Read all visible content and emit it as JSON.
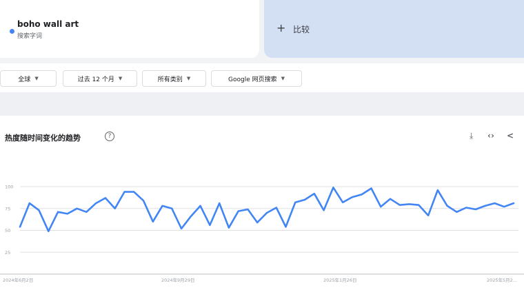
{
  "term": {
    "name": "boho wall art",
    "type": "搜索字词"
  },
  "compare": {
    "plus": "+",
    "label": "比较"
  },
  "filters": {
    "region": "全球",
    "time": "过去 12 个月",
    "category": "所有类别",
    "source": "Google 网页搜索"
  },
  "chart": {
    "title": "热度随时间变化的趋势",
    "help": "?",
    "download_icon": "⤓",
    "embed_icon": "‹›",
    "share_icon": "<"
  },
  "colors": {
    "series": "#4285f4",
    "grid": "#e0e0e0",
    "compare_bg": "#d3e0f3"
  },
  "chart_data": {
    "type": "line",
    "ylim": [
      0,
      100
    ],
    "yticks": [
      "100",
      "75",
      "50",
      "25"
    ],
    "xtick_labels": [
      "2024年6月2日",
      "2024年9月29日",
      "2025年1月26日",
      "2025年5月2..."
    ],
    "series": [
      {
        "values": [
          54,
          81,
          73,
          49,
          71,
          69,
          75,
          71,
          81,
          87,
          75,
          94,
          94,
          84,
          60,
          78,
          75,
          52,
          66,
          78,
          56,
          81,
          53,
          72,
          74,
          59,
          70,
          76,
          54,
          82,
          85,
          92,
          73,
          99,
          82,
          88,
          91,
          98,
          77,
          86,
          79,
          80,
          79,
          67,
          96,
          78,
          71,
          76,
          74,
          78,
          81,
          77,
          81
        ]
      }
    ]
  }
}
